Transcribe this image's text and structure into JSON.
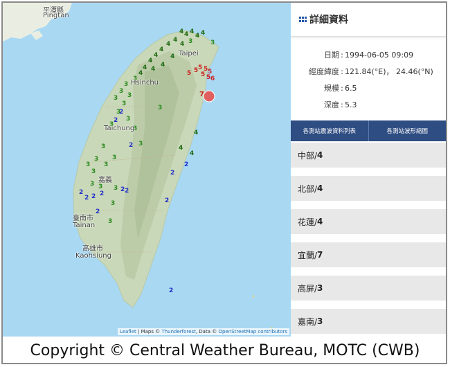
{
  "map": {
    "cities": [
      {
        "name": "平潭縣",
        "id": "pingtan-zh"
      },
      {
        "name": "Pingtan",
        "id": "pingtan-en"
      },
      {
        "name": "Taipei",
        "id": "taipei"
      },
      {
        "name": "Hsinchu",
        "id": "hsinchu"
      },
      {
        "name": "Taichung",
        "id": "taichung"
      },
      {
        "name": "嘉義",
        "id": "chiayi"
      },
      {
        "name": "臺南市",
        "id": "tainan-zh"
      },
      {
        "name": "Tainan",
        "id": "tainan-en"
      },
      {
        "name": "高雄市",
        "id": "kaohsiung-zh"
      },
      {
        "name": "Kaohsiung",
        "id": "kaohsiung-en"
      }
    ],
    "attribution": {
      "leaflet": "Leaflet",
      "maps": " | Maps © ",
      "thunderforest": "Thunderforest",
      "data": ", Data © ",
      "osm": "OpenStreetMap contributors"
    },
    "colors": {
      "intensity2": "#1f2ec8",
      "intensity3": "#2b8a1e",
      "intensity4": "#1f6b12",
      "intensity5": "#cc2222",
      "epicenter": "#e06060"
    }
  },
  "panel": {
    "title": "詳細資料",
    "fields": [
      {
        "key": "日期",
        "value": "1994-06-05 09:09"
      },
      {
        "key": "經度緯度",
        "value": "121.84(°E)， 24.46(°N)"
      },
      {
        "key": "規模",
        "value": "6.5"
      },
      {
        "key": "深度",
        "value": "5.3"
      }
    ],
    "buttons": [
      "各測站震波資料列表",
      "各測站波形縮圖"
    ],
    "regions": [
      {
        "name": "中部/",
        "intensity": "4"
      },
      {
        "name": "北部/",
        "intensity": "4"
      },
      {
        "name": "花蓮/",
        "intensity": "4"
      },
      {
        "name": "宜蘭/",
        "intensity": "7"
      },
      {
        "name": "高屏/",
        "intensity": "3"
      },
      {
        "name": "嘉南/",
        "intensity": "3"
      }
    ]
  },
  "copyright": "Copyright © Central Weather Bureau, MOTC (CWB)"
}
